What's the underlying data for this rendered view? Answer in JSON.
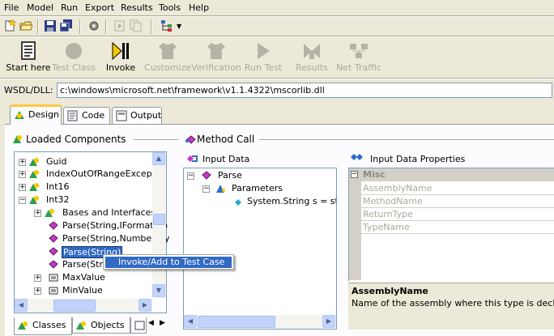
{
  "menu": [
    "File",
    "Model",
    "Run",
    "Export",
    "Results",
    "Tools",
    "Help"
  ],
  "toolbar_big": [
    {
      "label": "Start here",
      "enabled": true
    },
    {
      "label": "Test Class",
      "enabled": false
    },
    {
      "label": "Invoke",
      "enabled": true
    },
    {
      "label": "Customize",
      "enabled": false
    },
    {
      "label": "Verification",
      "enabled": false
    },
    {
      "label": "Run Test",
      "enabled": false
    },
    {
      "label": "Results",
      "enabled": false
    },
    {
      "label": "Net Traffic",
      "enabled": false
    }
  ],
  "wsdl": {
    "label": "WSDL/DLL:",
    "value": "c:\\windows\\microsoft.net\\framework\\v1.1.4322\\mscorlib.dll"
  },
  "tabs": [
    {
      "label": "Design",
      "active": true
    },
    {
      "label": "Code",
      "active": false
    },
    {
      "label": "Output",
      "active": false
    }
  ],
  "loaded_components": {
    "title": "Loaded Components",
    "items": [
      {
        "label": "Guid"
      },
      {
        "label": "IndexOutOfRangeExceptio"
      },
      {
        "label": "Int16"
      },
      {
        "label": "Int32"
      },
      {
        "label": "Bases and Interfaces"
      },
      {
        "label": "Parse(String,IFormatPro"
      },
      {
        "label": "Parse(String,NumberSty"
      },
      {
        "label": "Parse(String)"
      },
      {
        "label": "Parse(Strin"
      },
      {
        "label": "MaxValue"
      },
      {
        "label": "MinValue"
      }
    ]
  },
  "method_call": {
    "title": "Method Call",
    "input_data_label": "Input Data",
    "tree": {
      "root": "Parse",
      "parameters": "Parameters",
      "param": "System.String s = string"
    }
  },
  "properties": {
    "title": "Input Data Properties",
    "category": "Misc",
    "rows": [
      "AssemblyName",
      "MethodName",
      "ReturnType",
      "TypeName"
    ],
    "desc_title": "AssemblyName",
    "desc_text": "Name of the assembly where this type is declared"
  },
  "bottom_tabs": [
    {
      "label": "Classes"
    },
    {
      "label": "Objects"
    }
  ],
  "context_menu": {
    "item": "Invoke/Add to Test Case"
  }
}
